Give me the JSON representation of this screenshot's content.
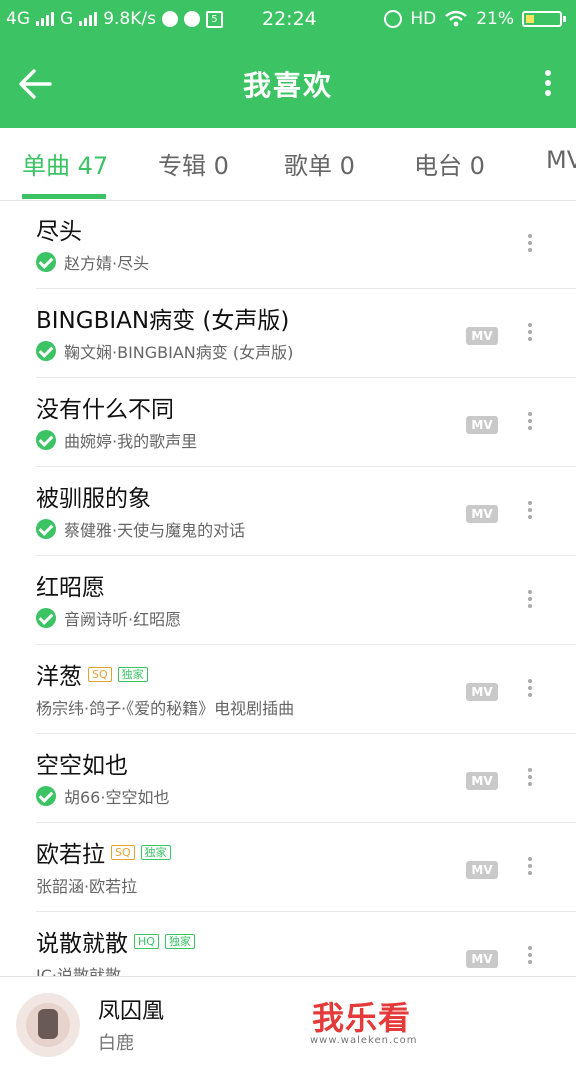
{
  "status_bar": {
    "network_1": "4G",
    "network_2": "G",
    "speed": "9.8K/s",
    "time": "22:24",
    "hd": "HD",
    "battery": "21%"
  },
  "header": {
    "title": "我喜欢",
    "back_icon": "back-arrow-icon",
    "more_icon": "more-vertical-icon",
    "background": "#3cc464"
  },
  "tabs": [
    {
      "label": "单曲 47",
      "active": true
    },
    {
      "label": "专辑 0",
      "active": false
    },
    {
      "label": "歌单 0",
      "active": false
    },
    {
      "label": "电台 0",
      "active": false
    },
    {
      "label": "MV",
      "active": false
    }
  ],
  "songs": [
    {
      "title": "尽头",
      "subtitle": "赵方婧·尽头",
      "downloaded": true,
      "mv": false,
      "badges": []
    },
    {
      "title": "BINGBIAN病变 (女声版)",
      "subtitle": "鞠文娴·BINGBIAN病变 (女声版)",
      "downloaded": true,
      "mv": true,
      "mv_label": "MV",
      "badges": []
    },
    {
      "title": "没有什么不同",
      "subtitle": "曲婉婷·我的歌声里",
      "downloaded": true,
      "mv": true,
      "mv_label": "MV",
      "badges": []
    },
    {
      "title": "被驯服的象",
      "subtitle": "蔡健雅·天使与魔鬼的对话",
      "downloaded": true,
      "mv": true,
      "mv_label": "MV",
      "badges": []
    },
    {
      "title": "红昭愿",
      "subtitle": "音阙诗听·红昭愿",
      "downloaded": true,
      "mv": false,
      "badges": []
    },
    {
      "title": "洋葱",
      "subtitle": "杨宗纬·鸽子·《爱的秘籍》电视剧插曲",
      "downloaded": false,
      "mv": true,
      "mv_label": "MV",
      "badges": [
        "SQ",
        "独家"
      ]
    },
    {
      "title": "空空如也",
      "subtitle": "胡66·空空如也",
      "downloaded": true,
      "mv": true,
      "mv_label": "MV",
      "badges": []
    },
    {
      "title": "欧若拉",
      "subtitle": "张韶涵·欧若拉",
      "downloaded": false,
      "mv": true,
      "mv_label": "MV",
      "badges": [
        "SQ",
        "独家"
      ]
    },
    {
      "title": "说散就散",
      "subtitle": "JC·说散就散",
      "downloaded": false,
      "mv": true,
      "mv_label": "MV",
      "badges": [
        "HQ",
        "独家"
      ]
    }
  ],
  "player": {
    "title": "凤囚凰",
    "artist": "白鹿"
  },
  "watermark": {
    "text": "我乐看",
    "url": "www.waleken.com"
  }
}
